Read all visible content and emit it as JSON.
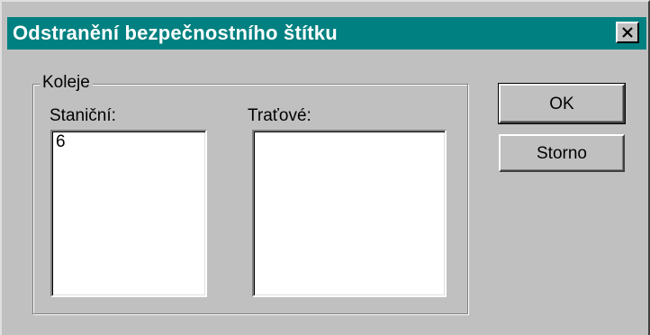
{
  "dialog": {
    "title": "Odstranění bezpečnostního štítku",
    "close_icon": "close-icon"
  },
  "group": {
    "legend": "Koleje",
    "station_label": "Staniční:",
    "track_label": "Traťové:",
    "station_items": [
      "6"
    ],
    "track_items": []
  },
  "buttons": {
    "ok_label": "OK",
    "cancel_label": "Storno"
  }
}
